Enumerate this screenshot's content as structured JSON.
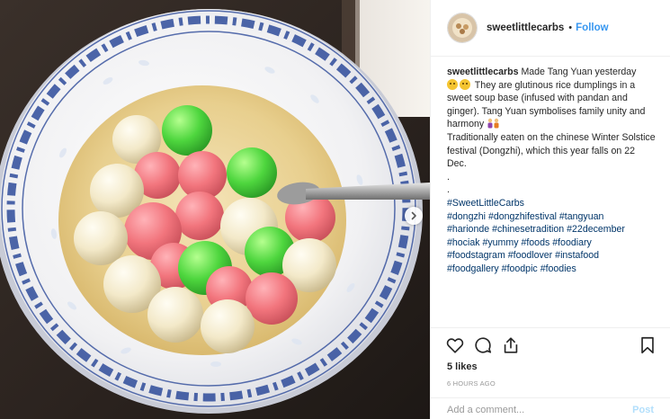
{
  "header": {
    "username": "sweetlittlecarbs",
    "separator": "•",
    "follow_label": "Follow"
  },
  "caption": {
    "username": "sweetlittlecarbs",
    "line1_text": "Made Tang Yuan yesterday",
    "line2_text": "They are glutinous rice dumplings in a sweet soup base (infused with pandan and ginger). Tang Yuan symbolises family unity and harmony",
    "line3_text": "Traditionally eaten on the chinese Winter Solstice festival (Dongzhi), which this year falls on 22 Dec.",
    "dot1": ".",
    "dot2": ".",
    "hashtags": [
      "#SweetLittleCarbs",
      "#dongzhi",
      "#dongzhifestival",
      "#tangyuan",
      "#harionde",
      "#chinesetradition",
      "#22december",
      "#hociak",
      "#yummy",
      "#foods",
      "#foodiary",
      "#foodstagram",
      "#foodlover",
      "#instafood",
      "#foodgallery",
      "#foodpic",
      "#foodies"
    ]
  },
  "actions": {
    "like_icon": "heart-icon",
    "comment_icon": "comment-icon",
    "share_icon": "share-icon",
    "save_icon": "bookmark-icon"
  },
  "likes": "5 likes",
  "timestamp": "6 HOURS AGO",
  "comment": {
    "placeholder": "Add a comment...",
    "post_label": "Post"
  },
  "media": {
    "description_icon": "photo",
    "next_icon": "chevron-right-icon"
  },
  "colors": {
    "link": "#003569",
    "follow": "#3897f0",
    "text": "#262626",
    "muted": "#999999",
    "border": "#efefef"
  }
}
